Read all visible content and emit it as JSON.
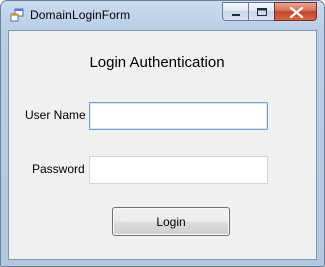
{
  "window": {
    "title": "DomainLoginForm",
    "controls": {
      "minimize": "minimize-icon",
      "maximize": "maximize-icon",
      "close": "close-icon"
    }
  },
  "form": {
    "heading": "Login Authentication",
    "username_label": "User Name",
    "username_value": "",
    "password_label": "Password",
    "password_value": "",
    "login_button": "Login"
  },
  "colors": {
    "titlebar": "#c9dbef",
    "client_bg": "#f0f0f0",
    "close_button": "#c2452b",
    "focus_border": "#7da2ce"
  }
}
